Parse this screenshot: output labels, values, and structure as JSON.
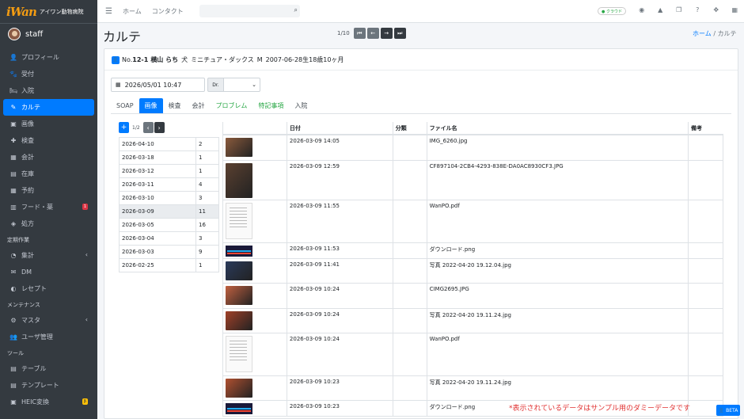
{
  "brand": {
    "logo": "iWan",
    "name": "アイワン動物病院"
  },
  "user": {
    "name": "staff"
  },
  "sidebar": {
    "items": [
      {
        "label": "プロフィール",
        "icon": "person-icon",
        "glyph": "👤"
      },
      {
        "label": "受付",
        "icon": "dog-icon",
        "glyph": "🐾"
      },
      {
        "label": "入院",
        "icon": "bed-icon",
        "glyph": "🛏"
      },
      {
        "label": "カルテ",
        "icon": "edit-icon",
        "glyph": "✎",
        "active": true
      },
      {
        "label": "画像",
        "icon": "image-icon",
        "glyph": "▣"
      },
      {
        "label": "検査",
        "icon": "syringe-icon",
        "glyph": "✚"
      },
      {
        "label": "会計",
        "icon": "calculator-icon",
        "glyph": "▦"
      },
      {
        "label": "在庫",
        "icon": "warehouse-icon",
        "glyph": "▤"
      },
      {
        "label": "予約",
        "icon": "calendar-icon",
        "glyph": "▦"
      },
      {
        "label": "フード・薬",
        "icon": "food-icon",
        "glyph": "▥",
        "badge": "1"
      },
      {
        "label": "処方",
        "icon": "pills-icon",
        "glyph": "◈"
      },
      {
        "header": "定期作業"
      },
      {
        "label": "集計",
        "icon": "chart-icon",
        "glyph": "◔",
        "chevron": true
      },
      {
        "label": "DM",
        "icon": "mail-icon",
        "glyph": "✉"
      },
      {
        "label": "レセプト",
        "icon": "receipt-icon",
        "glyph": "◐"
      },
      {
        "header": "メンテナンス"
      },
      {
        "label": "マスタ",
        "icon": "gear-icon",
        "glyph": "⚙",
        "chevron": true
      },
      {
        "label": "ユーザ管理",
        "icon": "users-icon",
        "glyph": "👥"
      },
      {
        "header": "ツール"
      },
      {
        "label": "テーブル",
        "icon": "table-icon",
        "glyph": "▤"
      },
      {
        "label": "テンプレート",
        "icon": "template-icon",
        "glyph": "▤"
      },
      {
        "label": "HEIC変換",
        "icon": "convert-icon",
        "glyph": "▣",
        "badge": "β",
        "warn": true
      }
    ]
  },
  "topbar": {
    "home": "ホーム",
    "contact": "コンタクト",
    "cloud": "● クラウド"
  },
  "page": {
    "title": "カルテ",
    "pager_count": "1/10",
    "breadcrumb_home": "ホーム",
    "breadcrumb_sep": "/",
    "breadcrumb_current": "カルテ"
  },
  "patient": {
    "no_label": "No.",
    "no": "12-1",
    "name": "横山 らち",
    "species": "犬",
    "breed": "ミニチュア・ダックス",
    "sex": "M",
    "birth": "2007-06-28生",
    "age": "18歳10ヶ月"
  },
  "form": {
    "date": "2026/05/01 10:47",
    "dr_label": "Dr.",
    "dr_value": "⌄"
  },
  "tabs": [
    {
      "label": "SOAP"
    },
    {
      "label": "画像",
      "active": true
    },
    {
      "label": "検査"
    },
    {
      "label": "会計"
    },
    {
      "label": "プロブレム",
      "green": true
    },
    {
      "label": "特記事項",
      "green": true
    },
    {
      "label": "入院"
    }
  ],
  "left": {
    "page": "1/2",
    "rows": [
      [
        "2026-04-10",
        "2"
      ],
      [
        "2026-03-18",
        "1"
      ],
      [
        "2026-03-12",
        "1"
      ],
      [
        "2026-03-11",
        "4"
      ],
      [
        "2026-03-10",
        "3"
      ],
      [
        "2026-03-09",
        "11"
      ],
      [
        "2026-03-05",
        "16"
      ],
      [
        "2026-03-04",
        "3"
      ],
      [
        "2026-03-03",
        "9"
      ],
      [
        "2026-02-25",
        "1"
      ]
    ],
    "selected": 5
  },
  "files": {
    "headers": [
      "",
      "日付",
      "分類",
      "ファイル名",
      "備考"
    ],
    "rows": [
      {
        "thumb": "photo",
        "color": "#8a5a3c",
        "date": "2026-03-09 14:05",
        "file": "IMG_6260.jpg",
        "h": 32
      },
      {
        "thumb": "photo-tall",
        "color": "#5a4030",
        "date": "2026-03-09 12:59",
        "file": "CF897104-2CB4-4293-838E-DA0AC8930CF3.JPG",
        "h": 50
      },
      {
        "thumb": "pdf",
        "date": "2026-03-09 11:55",
        "file": "WanPO.pdf",
        "h": 54
      },
      {
        "thumb": "graph",
        "date": "2026-03-09 11:53",
        "file": "ダウンロード.png",
        "h": 20
      },
      {
        "thumb": "photo",
        "color": "#2a3a5a",
        "date": "2026-03-09 11:41",
        "file": "写真 2022-04-20 19.12.04.jpg",
        "h": 31
      },
      {
        "thumb": "photo",
        "color": "#c06040",
        "date": "2026-03-09 10:24",
        "file": "CIMG2695.JPG",
        "h": 32
      },
      {
        "thumb": "photo",
        "color": "#a04028",
        "date": "2026-03-09 10:24",
        "file": "写真 2022-04-20 19.11.24.jpg",
        "h": 31
      },
      {
        "thumb": "pdf",
        "date": "2026-03-09 10:24",
        "file": "WanPO.pdf",
        "h": 54
      },
      {
        "thumb": "photo",
        "color": "#b05030",
        "date": "2026-03-09 10:23",
        "file": "写真 2022-04-20 19.11.24.jpg",
        "h": 31
      },
      {
        "thumb": "graph",
        "date": "2026-03-09 10:23",
        "file": "ダウンロード.png",
        "h": 20
      }
    ]
  },
  "note": "*表示されているデータはサンプル用のダミーデータです",
  "beta": "👤 BETA"
}
